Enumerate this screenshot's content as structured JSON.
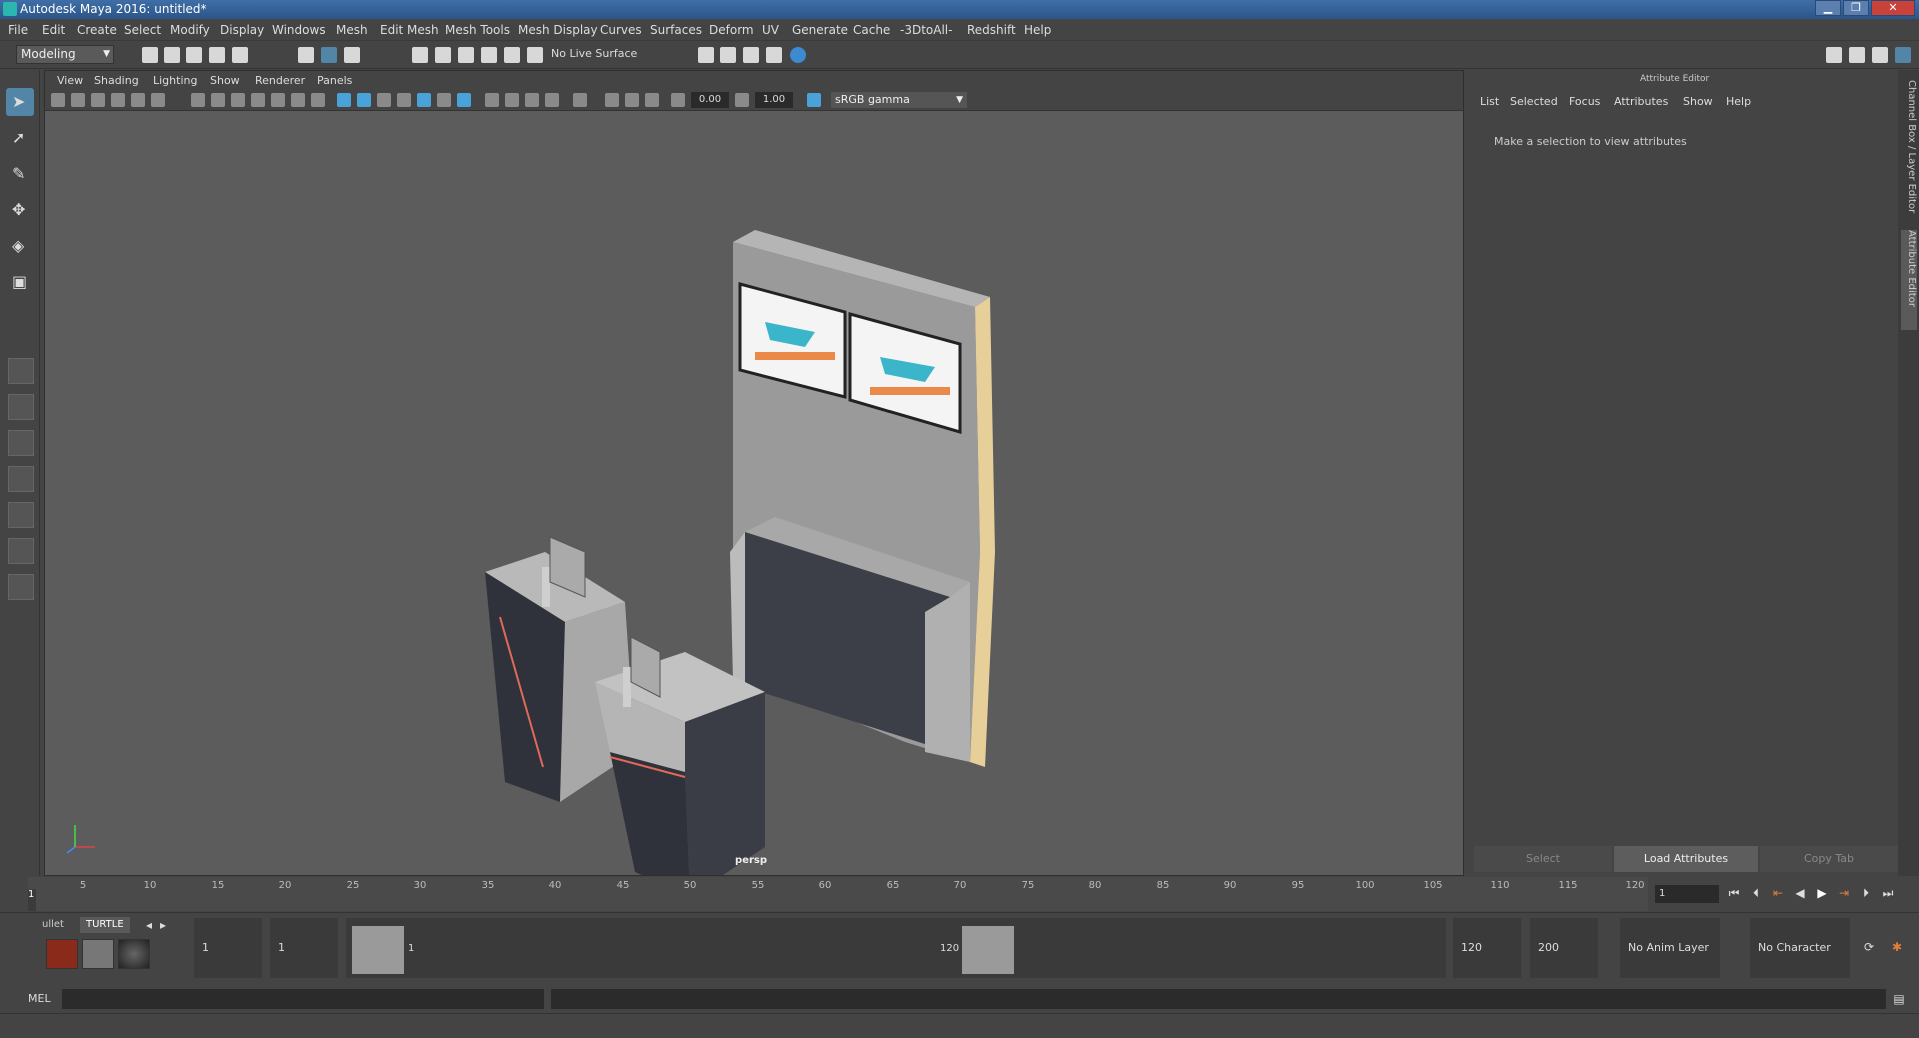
{
  "window": {
    "title": "Autodesk Maya 2016: untitled*",
    "min": "▁",
    "max": "❐",
    "close": "✕"
  },
  "menubar": [
    "File",
    "Edit",
    "Create",
    "Select",
    "Modify",
    "Display",
    "Windows",
    "Mesh",
    "Edit Mesh",
    "Mesh Tools",
    "Mesh Display",
    "Curves",
    "Surfaces",
    "Deform",
    "UV",
    "Generate",
    "Cache",
    "-3DtoAll-",
    "Redshift",
    "Help"
  ],
  "statusline": {
    "mode": "Modeling",
    "live_surface": "No Live Surface"
  },
  "viewport": {
    "menu": [
      "View",
      "Shading",
      "Lighting",
      "Show",
      "Renderer",
      "Panels"
    ],
    "exposure": "0.00",
    "gamma": "1.00",
    "color_space": "sRGB gamma",
    "camera": "persp"
  },
  "attribute_editor": {
    "title": "Attribute Editor",
    "menu": [
      "List",
      "Selected",
      "Focus",
      "Attributes",
      "Show",
      "Help"
    ],
    "hint": "Make a selection to view attributes",
    "buttons": [
      "Select",
      "Load Attributes",
      "Copy Tab"
    ]
  },
  "side_tabs": [
    "Channel Box / Layer Editor",
    "Attribute Editor"
  ],
  "timeslider": {
    "ticks": [
      "5",
      "10",
      "15",
      "20",
      "25",
      "30",
      "35",
      "40",
      "45",
      "50",
      "55",
      "60",
      "65",
      "70",
      "75",
      "80",
      "85",
      "90",
      "95",
      "100",
      "105",
      "110",
      "115",
      "120"
    ],
    "start_label": "1",
    "current_frame": "1"
  },
  "range": {
    "shelf_tabs": [
      "ullet",
      "TURTLE"
    ],
    "start": "1",
    "playback_start": "1",
    "slider_start": "1",
    "slider_end": "120",
    "playback_end": "120",
    "end": "200",
    "anim_layer": "No Anim Layer",
    "character_set": "No Character Set"
  },
  "cmdline": {
    "label": "MEL"
  }
}
